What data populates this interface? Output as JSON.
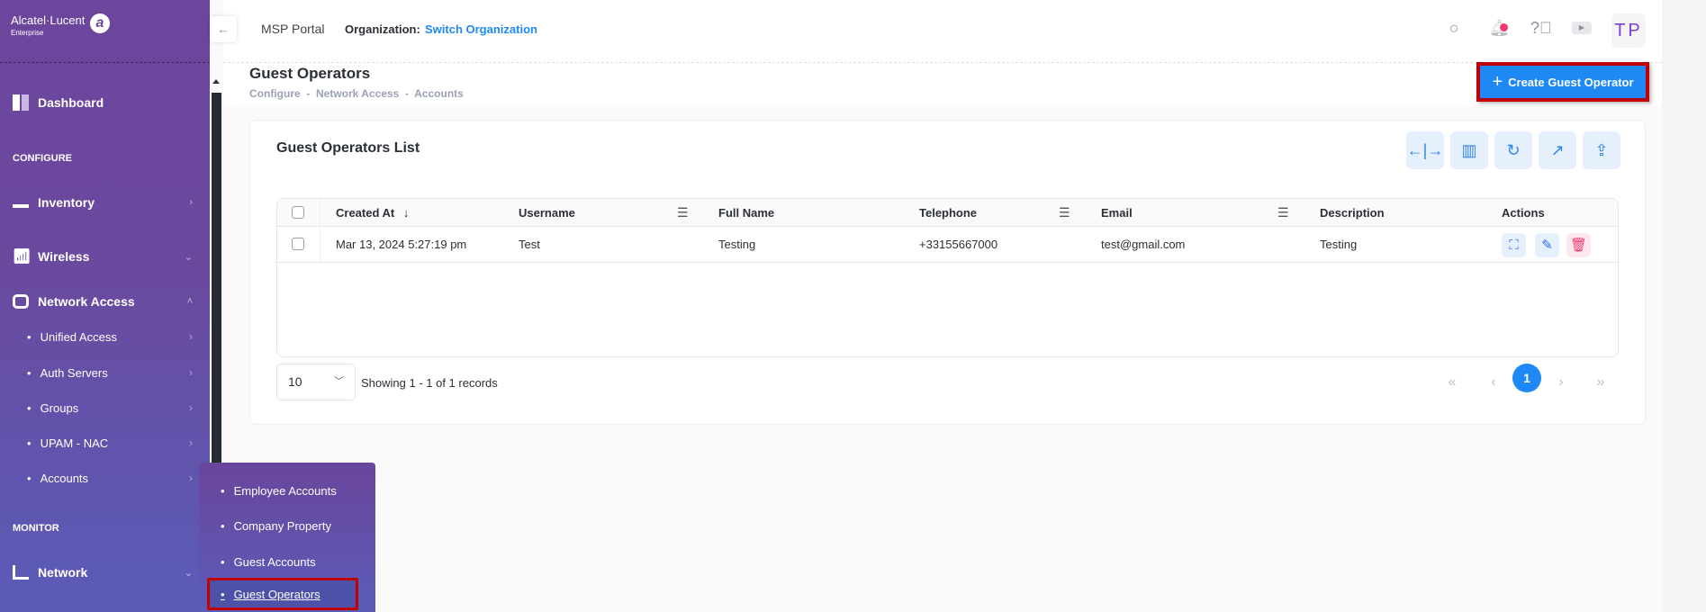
{
  "brand": {
    "name": "Alcatel·Lucent",
    "sub": "Enterprise",
    "mark": "a"
  },
  "header": {
    "portal": "MSP Portal",
    "org_label": "Organization:",
    "org_link": "Switch Organization",
    "avatar": "TP",
    "collapse_icon": "←"
  },
  "page": {
    "title": "Guest Operators",
    "breadcrumb": "Configure  -  Network Access  -  Accounts",
    "create_label": "Create Guest Operator"
  },
  "sidebar": {
    "dashboard": "Dashboard",
    "configure": "CONFIGURE",
    "inventory": "Inventory",
    "wireless": "Wireless",
    "network_access": "Network Access",
    "sub": [
      "Unified Access",
      "Auth Servers",
      "Groups",
      "UPAM - NAC",
      "Accounts"
    ],
    "monitor": "MONITOR",
    "network": "Network"
  },
  "popup": {
    "items": [
      "Employee Accounts",
      "Company Property",
      "Guest Accounts",
      "Guest Operators"
    ],
    "active": "Guest Operators"
  },
  "card": {
    "title": "Guest Operators List",
    "toolbar": [
      "resize-columns-icon",
      "column-layout-icon",
      "refresh-icon",
      "open-external-icon",
      "export-icon"
    ]
  },
  "table": {
    "columns": [
      "Created At",
      "Username",
      "Full Name",
      "Telephone",
      "Email",
      "Description",
      "Actions"
    ],
    "rows": [
      {
        "created": "Mar 13, 2024 5:27:19 pm",
        "username": "Test",
        "fullname": "Testing",
        "telephone": "+33155667000",
        "email": "test@gmail.com",
        "description": "Testing"
      }
    ]
  },
  "pagination": {
    "page_size": "10",
    "summary": "Showing 1 - 1 of 1 records",
    "current": "1"
  },
  "colors": {
    "primary": "#1e88f5",
    "sidebar": "#6c459c",
    "delete": "#f0386b",
    "highlight": "#c00000"
  }
}
